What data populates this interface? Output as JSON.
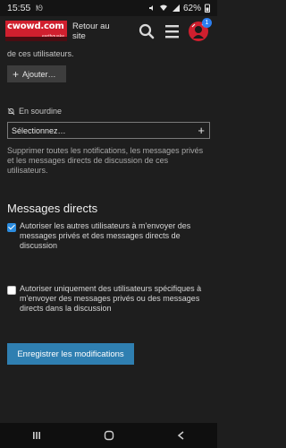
{
  "status_bar": {
    "time": "15:55",
    "extra": "ᘚ",
    "battery": "62%"
  },
  "header": {
    "logo_top": "cwowd.com",
    "logo_sub": "earthquake",
    "link": "Retour au site",
    "avatar_badge": "1"
  },
  "content": {
    "intro_tail": "de ces utilisateurs.",
    "add_button": "Ajouter…",
    "muted_label": "En sourdine",
    "select_value": "Sélectionnez…",
    "description": "Supprimer toutes les notifications, les messages privés et les messages directs de discussion de ces utilisateurs.",
    "section_title": "Messages directs",
    "option1": "Autoriser les autres utilisateurs à m'envoyer des messages privés et des messages directs de discussion",
    "option2": "Autoriser uniquement des utilisateurs spécifiques à m'envoyer des messages privés ou des messages directs dans la discussion",
    "save_button": "Enregistrer les modifications"
  },
  "colors": {
    "background": "#1e1e1e",
    "accent": "#2f7fb1",
    "brand": "#d01f2e",
    "checkbox_on": "#2b8cdf"
  },
  "icons": [
    "search-icon",
    "menu-icon",
    "bell-off-icon",
    "plus-icon",
    "back-icon",
    "home-icon",
    "recents-icon"
  ]
}
